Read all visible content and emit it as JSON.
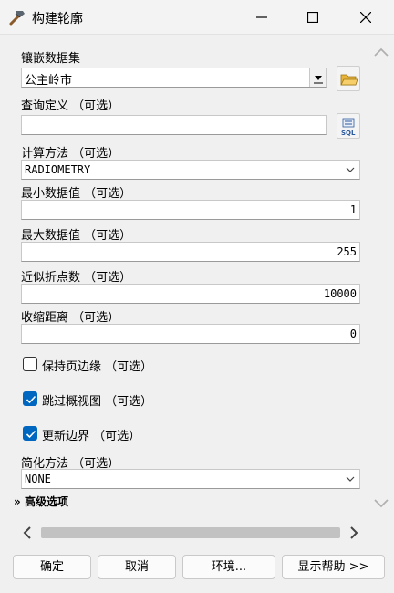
{
  "window": {
    "title": "构建轮廓",
    "icons": {
      "app": "hammer-icon",
      "minimize": "minimize-icon",
      "maximize": "maximize-icon",
      "close": "close-icon"
    }
  },
  "form": {
    "mosaic": {
      "label": "镶嵌数据集",
      "value": "公主岭市"
    },
    "query": {
      "label": "查询定义 （可选）",
      "value": ""
    },
    "method": {
      "label": "计算方法 （可选）",
      "value": "RADIOMETRY"
    },
    "min_value": {
      "label": "最小数据值 （可选）",
      "value": "1"
    },
    "max_value": {
      "label": "最大数据值 （可选）",
      "value": "255"
    },
    "vertices": {
      "label": "近似折点数 （可选）",
      "value": "10000"
    },
    "shrink": {
      "label": "收缩距离 （可选）",
      "value": "0"
    },
    "keep_edge": {
      "label": "保持页边缘 （可选）",
      "checked": false
    },
    "skip_overview": {
      "label": "跳过概视图 （可选）",
      "checked": true
    },
    "update_boundary": {
      "label": "更新边界 （可选）",
      "checked": true
    },
    "simplify": {
      "label": "简化方法 （可选）",
      "value": "NONE"
    },
    "advanced": {
      "label": "高级选项"
    }
  },
  "buttons": {
    "ok": "确定",
    "cancel": "取消",
    "env": "环境...",
    "help": "显示帮助 >>"
  },
  "colors": {
    "accent": "#0067c0",
    "background": "#f0f0f0"
  }
}
